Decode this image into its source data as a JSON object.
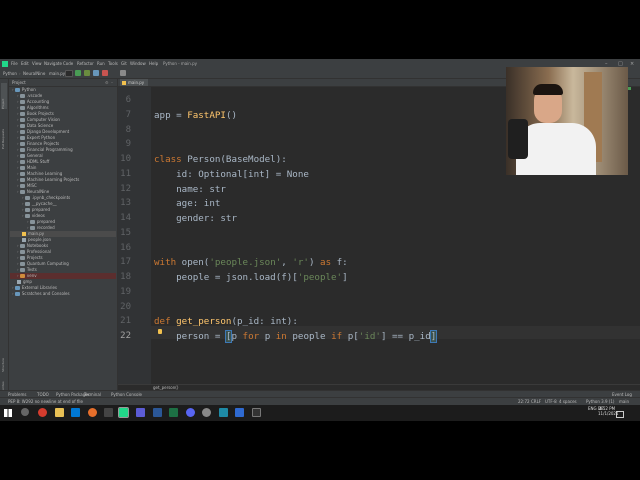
{
  "window": {
    "title": "Python - main.py",
    "menu": [
      "File",
      "Edit",
      "View",
      "Navigate",
      "Code",
      "Refactor",
      "Run",
      "Tools",
      "Git",
      "Window",
      "Help"
    ]
  },
  "navbar": {
    "breadcrumb": [
      "Python",
      "NeuralNine",
      "main.py"
    ]
  },
  "project_panel": {
    "header": "Project",
    "items": [
      {
        "label": "Python",
        "depth": 0,
        "icon": "folder"
      },
      {
        "label": ".vscode",
        "depth": 1,
        "icon": "folder"
      },
      {
        "label": "Accounting",
        "depth": 1,
        "icon": "folder"
      },
      {
        "label": "Algorithms",
        "depth": 1,
        "icon": "folder"
      },
      {
        "label": "Book Projects",
        "depth": 1,
        "icon": "folder"
      },
      {
        "label": "Computer Vision",
        "depth": 1,
        "icon": "folder"
      },
      {
        "label": "Data Science",
        "depth": 1,
        "icon": "folder"
      },
      {
        "label": "Django Development",
        "depth": 1,
        "icon": "folder"
      },
      {
        "label": "Expert Python",
        "depth": 1,
        "icon": "folder"
      },
      {
        "label": "Finance Projects",
        "depth": 1,
        "icon": "folder"
      },
      {
        "label": "Financial Programming",
        "depth": 1,
        "icon": "folder"
      },
      {
        "label": "General",
        "depth": 1,
        "icon": "folder"
      },
      {
        "label": "HDML Stuff",
        "depth": 1,
        "icon": "folder"
      },
      {
        "label": "Main",
        "depth": 1,
        "icon": "folder"
      },
      {
        "label": "Machine Learning",
        "depth": 1,
        "icon": "folder"
      },
      {
        "label": "Machine Learning Projects",
        "depth": 1,
        "icon": "folder"
      },
      {
        "label": "MISC",
        "depth": 1,
        "icon": "folder"
      },
      {
        "label": "NeuralNine",
        "depth": 1,
        "icon": "folder"
      },
      {
        "label": ".ipynb_checkpoints",
        "depth": 2,
        "icon": "folder"
      },
      {
        "label": "__pycache__",
        "depth": 2,
        "icon": "folder"
      },
      {
        "label": "prepared",
        "depth": 2,
        "icon": "folder"
      },
      {
        "label": "videos",
        "depth": 2,
        "icon": "folder"
      },
      {
        "label": "prepared",
        "depth": 3,
        "icon": "folder"
      },
      {
        "label": "recorded",
        "depth": 3,
        "icon": "folder"
      },
      {
        "label": "main.py",
        "depth": 2,
        "icon": "py",
        "selected": true
      },
      {
        "label": "people.json",
        "depth": 2,
        "icon": "file"
      },
      {
        "label": "Notebooks",
        "depth": 1,
        "icon": "folder"
      },
      {
        "label": "Professional",
        "depth": 1,
        "icon": "folder"
      },
      {
        "label": "Projects",
        "depth": 1,
        "icon": "folder"
      },
      {
        "label": "Quantum Computing",
        "depth": 1,
        "icon": "folder"
      },
      {
        "label": "Tests",
        "depth": 1,
        "icon": "folder"
      },
      {
        "label": "venv",
        "depth": 1,
        "icon": "folder-orange",
        "highlight": true
      },
      {
        "label": "gmp",
        "depth": 1,
        "icon": "file"
      },
      {
        "label": "External Libraries",
        "depth": 0,
        "icon": "folder"
      },
      {
        "label": "Scratches and Consoles",
        "depth": 0,
        "icon": "folder"
      }
    ]
  },
  "editor": {
    "tab": "main.py",
    "lines": [
      {
        "n": "6",
        "tokens": []
      },
      {
        "n": "7",
        "tokens": [
          [
            "",
            "app = "
          ],
          [
            "fn",
            "FastAPI"
          ],
          [
            "",
            "()"
          ]
        ]
      },
      {
        "n": "8",
        "tokens": []
      },
      {
        "n": "9",
        "tokens": []
      },
      {
        "n": "10",
        "tokens": [
          [
            "kw",
            "class "
          ],
          [
            "",
            "Person(BaseModel):"
          ]
        ]
      },
      {
        "n": "11",
        "tokens": [
          [
            "",
            "    id: Optional[int] = None"
          ]
        ]
      },
      {
        "n": "12",
        "tokens": [
          [
            "",
            "    name: str"
          ]
        ]
      },
      {
        "n": "13",
        "tokens": [
          [
            "",
            "    age: int"
          ]
        ]
      },
      {
        "n": "14",
        "tokens": [
          [
            "",
            "    gender: str"
          ]
        ]
      },
      {
        "n": "15",
        "tokens": []
      },
      {
        "n": "16",
        "tokens": []
      },
      {
        "n": "17",
        "tokens": [
          [
            "kw",
            "with "
          ],
          [
            "",
            "open("
          ],
          [
            "str",
            "'people.json'"
          ],
          [
            "",
            ", "
          ],
          [
            "str",
            "'r'"
          ],
          [
            "",
            ") "
          ],
          [
            "kw",
            "as "
          ],
          [
            "",
            "f:"
          ]
        ]
      },
      {
        "n": "18",
        "tokens": [
          [
            "",
            "    people = json.load(f)["
          ],
          [
            "str",
            "'people'"
          ],
          [
            "",
            "]"
          ]
        ]
      },
      {
        "n": "19",
        "tokens": []
      },
      {
        "n": "20",
        "tokens": []
      },
      {
        "n": "21",
        "tokens": [
          [
            "kw",
            "def "
          ],
          [
            "fn",
            "get_person"
          ],
          [
            "",
            "(p_id: int):"
          ]
        ]
      },
      {
        "n": "22",
        "tokens": [
          [
            "",
            "    person = "
          ],
          [
            "br",
            "["
          ],
          [
            "",
            "p "
          ],
          [
            "kw",
            "for "
          ],
          [
            "",
            "p "
          ],
          [
            "kw",
            "in "
          ],
          [
            "",
            "people "
          ],
          [
            "kw",
            "if "
          ],
          [
            "",
            "p["
          ],
          [
            "str",
            "'id'"
          ],
          [
            "",
            "] == p_id"
          ],
          [
            "br",
            "]"
          ]
        ]
      }
    ],
    "breadcrumb": "get_person()"
  },
  "tool_tabs": [
    "Problems",
    "TODO",
    "Python Packages",
    "Terminal",
    "Python Console"
  ],
  "tool_tabs_right": "Event Log",
  "status": {
    "message": "PEP 8: W292 no newline at end of file",
    "cursor": "22:72",
    "line_sep": "CRLF",
    "encoding": "UTF-8",
    "indent": "4 spaces",
    "interpreter": "Python 3.9 (1)",
    "branch": "main"
  },
  "taskbar": {
    "time": "4:52 PM",
    "date": "11/1/2021",
    "lang": "ENG DE"
  }
}
